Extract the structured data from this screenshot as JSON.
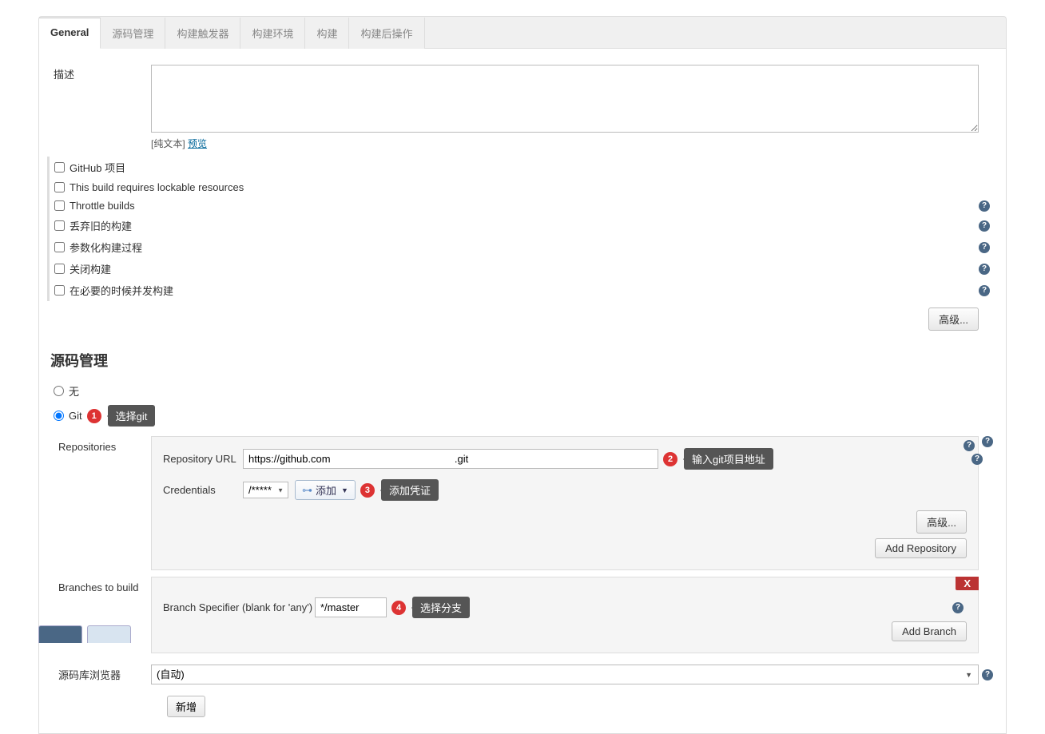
{
  "tabs": {
    "general": "General",
    "source": "源码管理",
    "triggers": "构建触发器",
    "env": "构建环境",
    "build": "构建",
    "post": "构建后操作"
  },
  "desc": {
    "label": "描述",
    "hint_prefix": "[纯文本] ",
    "preview_link": "预览"
  },
  "checks": {
    "github_project": "GitHub 项目",
    "lockable": "This build requires lockable resources",
    "throttle": "Throttle builds",
    "discard": "丢弃旧的构建",
    "parameterized": "参数化构建过程",
    "disable": "关闭构建",
    "concurrent": "在必要的时候并发构建"
  },
  "advanced_btn": "高级...",
  "scm": {
    "title": "源码管理",
    "none": "无",
    "git": "Git",
    "annot1": "选择git",
    "repositories": "Repositories",
    "repo_url_label": "Repository URL",
    "repo_url_value": "https://github.com                                           .git",
    "annot2": "输入git项目地址",
    "credentials_label": "Credentials",
    "credentials_value": "          /*****",
    "add_btn": "添加",
    "annot3": "添加凭证",
    "add_repo_btn": "Add Repository",
    "branches_label": "Branches to build",
    "branch_spec_label": "Branch Specifier (blank for 'any')",
    "branch_spec_value": "*/master",
    "annot4": "选择分支",
    "add_branch_btn": "Add Branch",
    "x_btn": "X",
    "browser_label": "源码库浏览器",
    "browser_value": "(自动)",
    "new_btn": "新增"
  },
  "badges": {
    "b1": "1",
    "b2": "2",
    "b3": "3",
    "b4": "4"
  },
  "help_glyph": "?"
}
